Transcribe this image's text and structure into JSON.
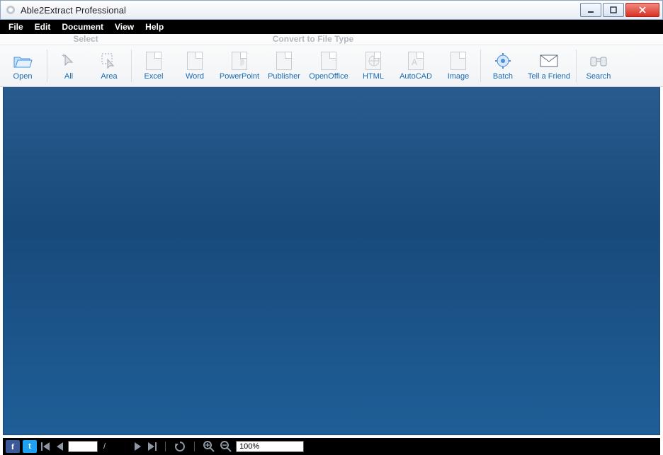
{
  "window": {
    "title": "Able2Extract Professional"
  },
  "menu": {
    "file": "File",
    "edit": "Edit",
    "document": "Document",
    "view": "View",
    "help": "Help"
  },
  "toolbar_sections": {
    "select": "Select",
    "convert": "Convert to File Type"
  },
  "toolbar": {
    "open": "Open",
    "all": "All",
    "area": "Area",
    "excel": "Excel",
    "word": "Word",
    "powerpoint": "PowerPoint",
    "publisher": "Publisher",
    "openoffice": "OpenOffice",
    "html": "HTML",
    "autocad": "AutoCAD",
    "image": "Image",
    "batch": "Batch",
    "tell_a_friend": "Tell a Friend",
    "search": "Search"
  },
  "footer": {
    "fb_label": "f",
    "tw_label": "t",
    "page_separator": "/",
    "zoom": "100%"
  }
}
